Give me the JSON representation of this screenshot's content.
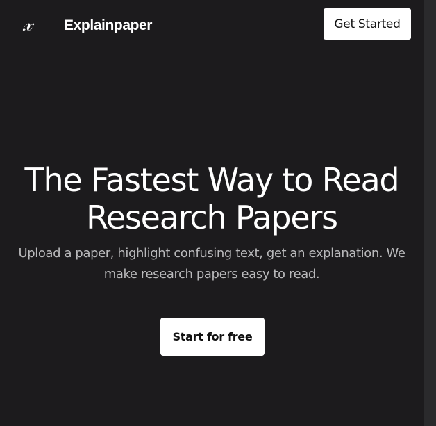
{
  "header": {
    "logo_glyph": "𝓍",
    "logo_icon": "italic-x-icon",
    "brand_name": "Explainpaper",
    "cta_label": "Get Started"
  },
  "hero": {
    "title": "The Fastest Way to Read Research Papers",
    "subtitle": "Upload a paper, highlight confusing text, get an explanation. We make research papers easy to read.",
    "cta_label": "Start for free"
  },
  "colors": {
    "background": "#1c1b1d",
    "button_bg": "#ffffff",
    "button_text": "#111111",
    "subtitle_text": "#b9b9bb"
  }
}
